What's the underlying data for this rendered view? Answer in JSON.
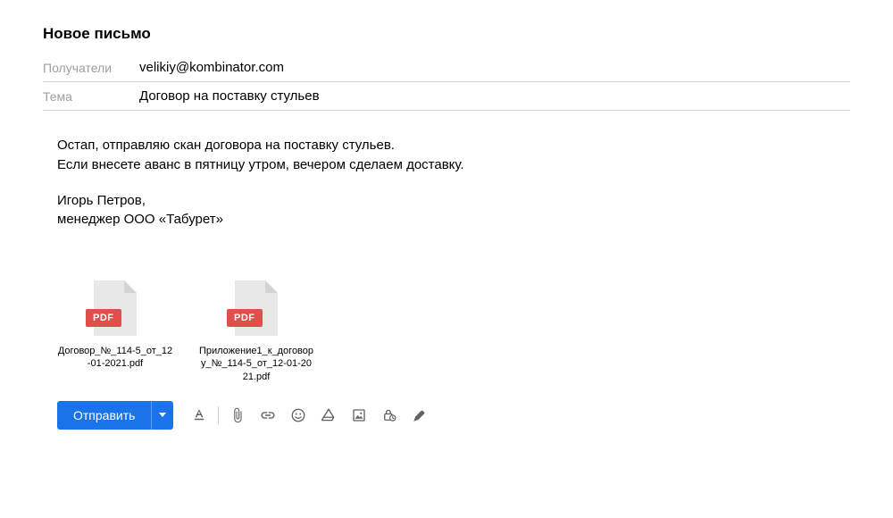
{
  "title": "Новое письмо",
  "fields": {
    "recipients_label": "Получатели",
    "recipients_value": "velikiy@kombinator.com",
    "subject_label": "Тема",
    "subject_value": "Договор на поставку стульев"
  },
  "body": {
    "line1": "Остап, отправляю скан договора на поставку стульев.",
    "line2": "Если внесете аванс в пятницу утром, вечером сделаем доставку.",
    "sig1": "Игорь Петров,",
    "sig2": "менеджер ООО «Табурет»"
  },
  "attachments": [
    {
      "type": "PDF",
      "name": "Договор_№_114-5_от_12-01-2021.pdf"
    },
    {
      "type": "PDF",
      "name": "Приложение1_к_договору_№_114-5_от_12-01-2021.pdf"
    }
  ],
  "actions": {
    "send": "Отправить"
  }
}
